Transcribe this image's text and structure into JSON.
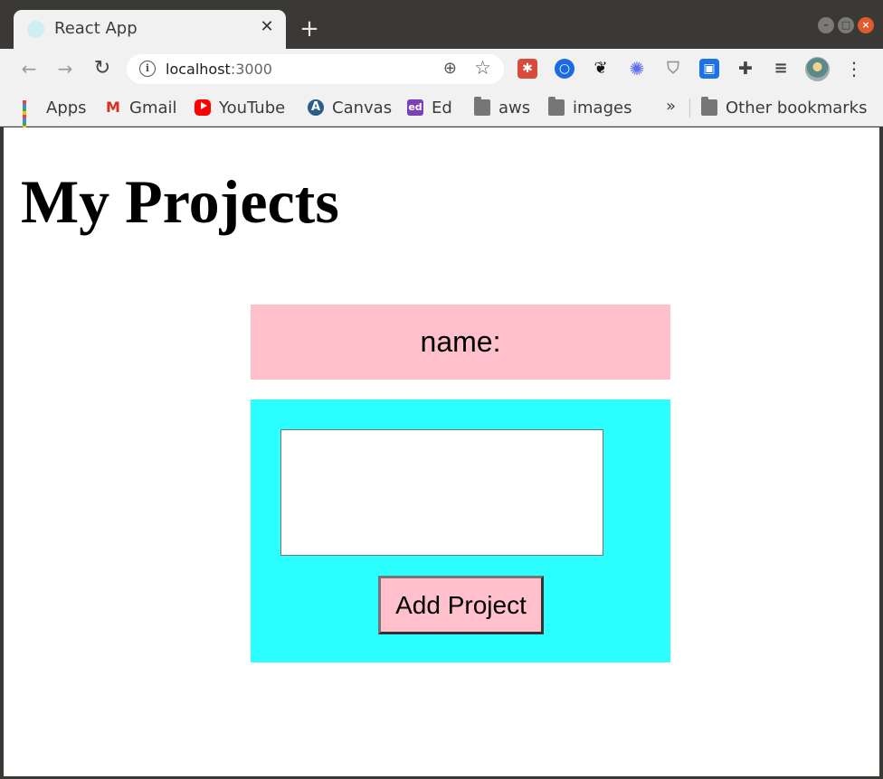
{
  "browser": {
    "tab": {
      "title": "React App",
      "close_glyph": "✕"
    },
    "new_tab_glyph": "+",
    "window_controls": [
      "–",
      "□",
      "×"
    ],
    "nav": {
      "back_glyph": "←",
      "forward_glyph": "→",
      "reload_glyph": "↻"
    },
    "omnibox": {
      "host": "localhost",
      "port": ":3000",
      "info_glyph": "i",
      "zoom_glyph": "⊕",
      "star_glyph": "☆"
    },
    "extensions": [
      {
        "name": "bug-extension-icon",
        "glyph": "✱"
      },
      {
        "name": "ring-extension-icon",
        "glyph": "○"
      },
      {
        "name": "paw-extension-icon",
        "glyph": "❦"
      },
      {
        "name": "asterisk-extension-icon",
        "glyph": "✺"
      },
      {
        "name": "shield-extension-icon",
        "glyph": "⛉"
      },
      {
        "name": "box-extension-icon",
        "glyph": "▣"
      },
      {
        "name": "puzzle-extension-icon",
        "glyph": "✚"
      },
      {
        "name": "media-list-icon",
        "glyph": "≡"
      }
    ],
    "menu_glyph": "⋮",
    "bookmarks": [
      {
        "label": "Apps",
        "icon": "apps-grid-icon"
      },
      {
        "label": "Gmail",
        "icon": "gmail-icon"
      },
      {
        "label": "YouTube",
        "icon": "youtube-icon"
      },
      {
        "label": "Canvas",
        "icon": "canvas-icon"
      },
      {
        "label": "Ed",
        "icon": "ed-icon"
      },
      {
        "label": "aws",
        "icon": "folder-icon"
      },
      {
        "label": "images",
        "icon": "folder-icon"
      }
    ],
    "overflow_glyph": "»",
    "other_bookmarks": "Other bookmarks"
  },
  "page": {
    "title": "My Projects",
    "name_label": "name:",
    "project_input": {
      "value": "",
      "placeholder": ""
    },
    "add_button_label": "Add Project"
  },
  "colors": {
    "name_box": "#ffc0cb",
    "form_box": "#2bffff",
    "button": "#ffc0cb"
  }
}
